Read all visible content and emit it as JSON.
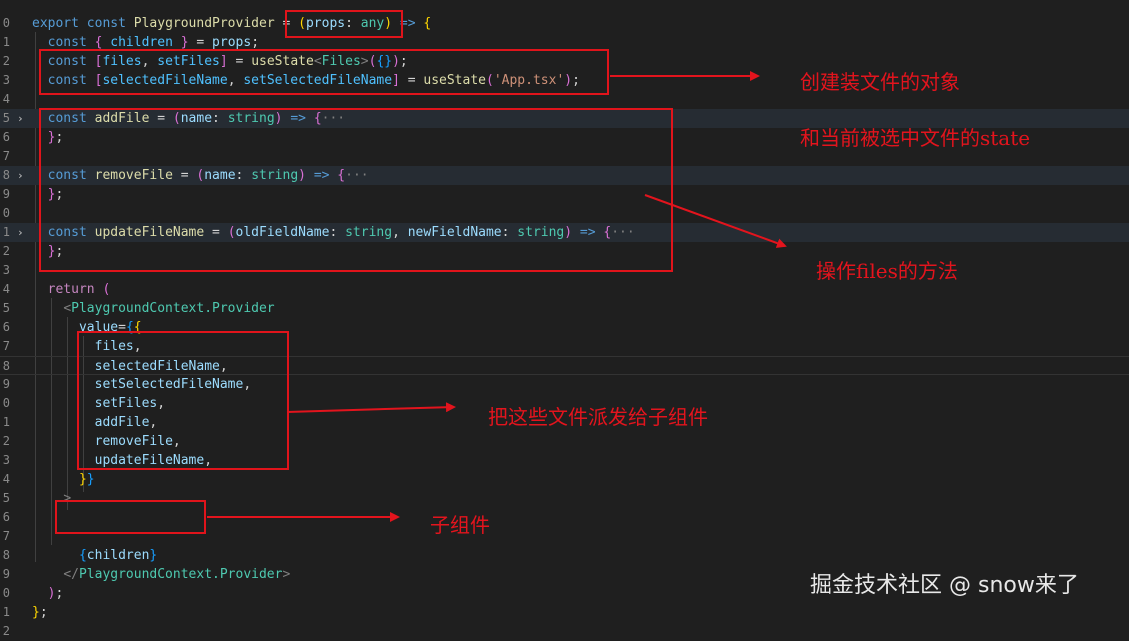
{
  "editor": {
    "lines": [
      {
        "no": "0",
        "fold": "",
        "hl": false,
        "html": "<span class=\"tk-kw\">export</span> <span class=\"tk-kw\">const</span> <span class=\"tk-fn\">PlaygroundProvider</span> = <span class=\"tk-br1\">(</span><span class=\"tk-var\">props</span>: <span class=\"tk-type\">any</span><span class=\"tk-br1\">)</span> <span class=\"tk-kw\">=&gt;</span> <span class=\"tk-br1\">{</span>"
      },
      {
        "no": "1",
        "fold": "",
        "hl": false,
        "html": "  <span class=\"tk-kw\">const</span> <span class=\"tk-br2\">{</span> <span class=\"tk-const\">children</span> <span class=\"tk-br2\">}</span> = <span class=\"tk-var\">props</span>;"
      },
      {
        "no": "2",
        "fold": "",
        "hl": false,
        "html": "  <span class=\"tk-kw\">const</span> <span class=\"tk-br2\">[</span><span class=\"tk-const\">files</span>, <span class=\"tk-const\">setFiles</span><span class=\"tk-br2\">]</span> = <span class=\"tk-fn\">useState</span><span class=\"tk-tag\">&lt;</span><span class=\"tk-type\">Files</span><span class=\"tk-tag\">&gt;</span><span class=\"tk-br2\">(</span><span class=\"tk-br3\">{}</span><span class=\"tk-br2\">)</span>;"
      },
      {
        "no": "3",
        "fold": "",
        "hl": false,
        "html": "  <span class=\"tk-kw\">const</span> <span class=\"tk-br2\">[</span><span class=\"tk-const\">selectedFileName</span>, <span class=\"tk-const\">setSelectedFileName</span><span class=\"tk-br2\">]</span> = <span class=\"tk-fn\">useState</span><span class=\"tk-br2\">(</span><span class=\"tk-str\">'App.tsx'</span><span class=\"tk-br2\">)</span>;"
      },
      {
        "no": "4",
        "fold": "",
        "hl": false,
        "html": ""
      },
      {
        "no": "5",
        "fold": "›",
        "hl": true,
        "html": "  <span class=\"tk-kw\">const</span> <span class=\"tk-fn\">addFile</span> = <span class=\"tk-br2\">(</span><span class=\"tk-var\">name</span>: <span class=\"tk-type\">string</span><span class=\"tk-br2\">)</span> <span class=\"tk-kw\">=&gt;</span> <span class=\"tk-br2\">{</span><span class=\"tk-dim\">···</span>"
      },
      {
        "no": "6",
        "fold": "",
        "hl": false,
        "html": "  <span class=\"tk-br2\">}</span>;"
      },
      {
        "no": "7",
        "fold": "",
        "hl": false,
        "html": ""
      },
      {
        "no": "8",
        "fold": "›",
        "hl": true,
        "html": "  <span class=\"tk-kw\">const</span> <span class=\"tk-fn\">removeFile</span> = <span class=\"tk-br2\">(</span><span class=\"tk-var\">name</span>: <span class=\"tk-type\">string</span><span class=\"tk-br2\">)</span> <span class=\"tk-kw\">=&gt;</span> <span class=\"tk-br2\">{</span><span class=\"tk-dim\">···</span>"
      },
      {
        "no": "9",
        "fold": "",
        "hl": false,
        "html": "  <span class=\"tk-br2\">}</span>;"
      },
      {
        "no": "0",
        "fold": "",
        "hl": false,
        "html": ""
      },
      {
        "no": "1",
        "fold": "›",
        "hl": true,
        "html": "  <span class=\"tk-kw\">const</span> <span class=\"tk-fn\">updateFileName</span> = <span class=\"tk-br2\">(</span><span class=\"tk-var\">oldFieldName</span>: <span class=\"tk-type\">string</span>, <span class=\"tk-var\">newFieldName</span>: <span class=\"tk-type\">string</span><span class=\"tk-br2\">)</span> <span class=\"tk-kw\">=&gt;</span> <span class=\"tk-br2\">{</span><span class=\"tk-dim\">···</span>"
      },
      {
        "no": "2",
        "fold": "",
        "hl": false,
        "html": "  <span class=\"tk-br2\">}</span>;"
      },
      {
        "no": "3",
        "fold": "",
        "hl": false,
        "html": ""
      },
      {
        "no": "4",
        "fold": "",
        "hl": false,
        "html": "  <span class=\"tk-ctl\">return</span> <span class=\"tk-br2\">(</span>"
      },
      {
        "no": "5",
        "fold": "",
        "hl": false,
        "html": "    <span class=\"tk-tag\">&lt;</span><span class=\"tk-type\">PlaygroundContext.Provider</span>"
      },
      {
        "no": "6",
        "fold": "",
        "hl": false,
        "html": "      <span class=\"tk-var\">value</span>=<span class=\"tk-br3\">{</span><span class=\"tk-br1\">{</span>"
      },
      {
        "no": "7",
        "fold": "",
        "hl": false,
        "html": "        <span class=\"tk-var\">files</span>,"
      },
      {
        "no": "8",
        "fold": "",
        "hl": false,
        "cur": true,
        "html": "        <span class=\"tk-var\">selectedFileName</span>,"
      },
      {
        "no": "9",
        "fold": "",
        "hl": false,
        "html": "        <span class=\"tk-var\">setSelectedFileName</span>,"
      },
      {
        "no": "0",
        "fold": "",
        "hl": false,
        "html": "        <span class=\"tk-var\">setFiles</span>,"
      },
      {
        "no": "1",
        "fold": "",
        "hl": false,
        "html": "        <span class=\"tk-var\">addFile</span>,"
      },
      {
        "no": "2",
        "fold": "",
        "hl": false,
        "html": "        <span class=\"tk-var\">removeFile</span>,"
      },
      {
        "no": "3",
        "fold": "",
        "hl": false,
        "html": "        <span class=\"tk-var\">updateFileName</span>,"
      },
      {
        "no": "4",
        "fold": "",
        "hl": false,
        "html": "      <span class=\"tk-br1\">}</span><span class=\"tk-br3\">}</span>"
      },
      {
        "no": "5",
        "fold": "",
        "hl": false,
        "html": "    <span class=\"tk-tag\">&gt;</span>"
      },
      {
        "no": "6",
        "fold": "",
        "hl": false,
        "html": ""
      },
      {
        "no": "7",
        "fold": "",
        "hl": false,
        "html": ""
      },
      {
        "no": "8",
        "fold": "",
        "hl": false,
        "html": "      <span class=\"tk-br3\">{</span><span class=\"tk-var\">children</span><span class=\"tk-br3\">}</span>"
      },
      {
        "no": "9",
        "fold": "",
        "hl": false,
        "html": "    <span class=\"tk-tag\">&lt;/</span><span class=\"tk-type\">PlaygroundContext.Provider</span><span class=\"tk-tag\">&gt;</span>"
      },
      {
        "no": "0",
        "fold": "",
        "hl": false,
        "html": "  <span class=\"tk-br2\">)</span>;"
      },
      {
        "no": "1",
        "fold": "",
        "hl": false,
        "html": "<span class=\"tk-br1\">}</span>;"
      },
      {
        "no": "2",
        "fold": "",
        "hl": false,
        "html": ""
      }
    ]
  },
  "annotations": {
    "state_line1": "创建装文件的对象",
    "state_line2": "和当前被选中文件的state",
    "methods": "操作files的方法",
    "dispatch": "把这些文件派发给子组件",
    "children": "子组件"
  },
  "watermark": "掘金技术社区 @ snow来了",
  "colors": {
    "background": "#1f1f1f",
    "annotation": "#e3141d",
    "folded_line_highlight": "#262c33"
  }
}
